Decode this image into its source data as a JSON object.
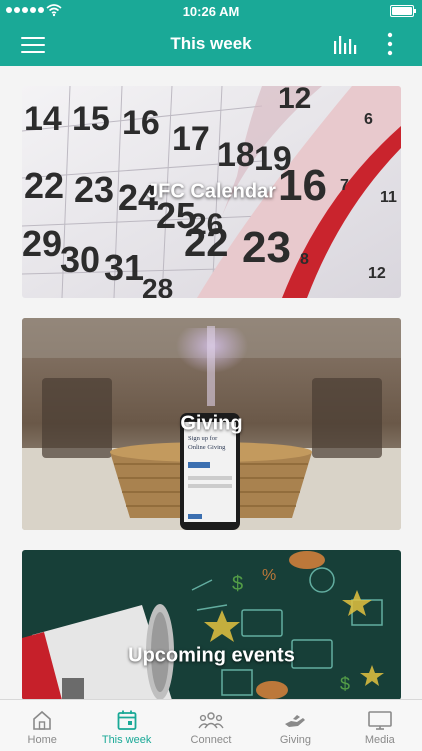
{
  "status_bar": {
    "time": "10:26 AM"
  },
  "header": {
    "title": "This week"
  },
  "cards": [
    {
      "label": "JFC Calendar"
    },
    {
      "label": "Giving"
    },
    {
      "label": "Upcoming events"
    }
  ],
  "giving_phone": {
    "line1": "Sign up for",
    "line2": "Online Giving"
  },
  "calendar_numbers": [
    "14",
    "15",
    "16",
    "17",
    "18",
    "19",
    "22",
    "23",
    "24",
    "25",
    "26",
    "29",
    "30",
    "31",
    "22",
    "23",
    "12",
    "16",
    "6",
    "7",
    "11",
    "8",
    "12",
    "28"
  ],
  "tabs": [
    {
      "label": "Home",
      "icon": "home-icon"
    },
    {
      "label": "This week",
      "icon": "calendar-icon"
    },
    {
      "label": "Connect",
      "icon": "people-icon"
    },
    {
      "label": "Giving",
      "icon": "giving-hand-icon"
    },
    {
      "label": "Media",
      "icon": "monitor-icon"
    }
  ],
  "colors": {
    "brand": "#1aa997",
    "tab_inactive": "#8a8a8a"
  }
}
